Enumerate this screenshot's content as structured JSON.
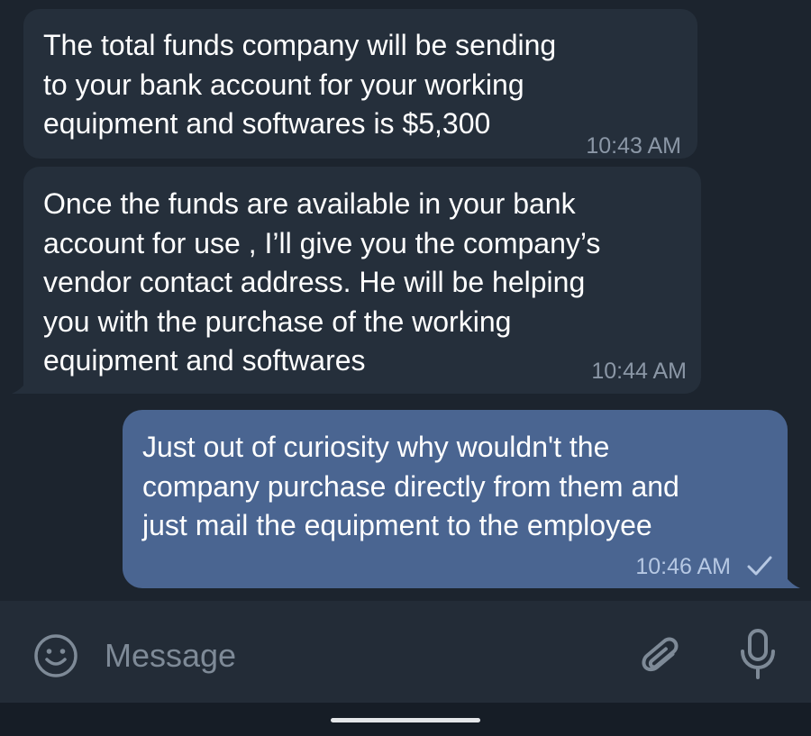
{
  "messages": [
    {
      "direction": "incoming",
      "lines": [
        "The total funds company will be sending",
        "to your bank account for your working",
        "equipment and softwares is $5,300"
      ],
      "time": "10:43 AM"
    },
    {
      "direction": "incoming",
      "lines": [
        "Once the funds are available in your bank",
        "account for use , I’ll give you the company’s",
        "vendor contact address. He will be helping",
        "you with the purchase of the working",
        "equipment and softwares"
      ],
      "time": "10:44 AM"
    },
    {
      "direction": "outgoing",
      "lines": [
        "Just out of curiosity why wouldn't the",
        "company purchase directly from them and",
        "just mail the equipment to the employee"
      ],
      "time": "10:46 AM",
      "status_icon": "single-check-icon"
    }
  ],
  "composer": {
    "placeholder": "Message",
    "emoji_icon": "emoji-icon",
    "attach_icon": "paperclip-icon",
    "mic_icon": "microphone-icon"
  },
  "colors": {
    "chat_background": "#1c242e",
    "incoming_bubble": "#252f3b",
    "outgoing_bubble": "#4a6591",
    "composer_background": "#232c37",
    "icon_color": "#7e8a97"
  }
}
